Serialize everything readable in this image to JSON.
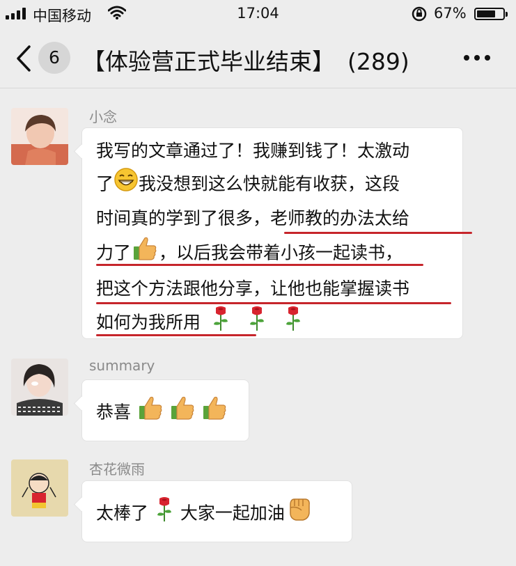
{
  "status_bar": {
    "carrier": "中国移动",
    "time": "17:04",
    "battery_percent": "67%",
    "battery_level": 0.67
  },
  "nav": {
    "unread_count": "6",
    "title": "【体验营正式毕业结束】",
    "member_count": "(289)"
  },
  "messages": [
    {
      "sender": "小念",
      "lines": [
        {
          "parts": [
            "我写的文章通过了！我赚到钱了！太激动"
          ]
        },
        {
          "parts": [
            "了",
            "{grin-emoji}",
            "我没想到这么快就能有收获，这段"
          ]
        },
        {
          "parts": [
            "时间真的学到了很多，",
            "老师教的办法太给"
          ]
        },
        {
          "parts": [
            "力了",
            "{thumbs-up-emoji}",
            "，以后我会带着小孩一起读书，"
          ]
        },
        {
          "parts": [
            "把这个方法跟他分享，让他也能掌握读书"
          ]
        },
        {
          "parts": [
            "如何为我所用",
            "{rose-emoji}",
            "{rose-emoji}",
            "{rose-emoji}"
          ]
        }
      ]
    },
    {
      "sender": "summary",
      "text": "恭喜",
      "emojis": [
        "thumbs-up-emoji",
        "thumbs-up-emoji",
        "thumbs-up-emoji"
      ]
    },
    {
      "sender": "杏花微雨",
      "text_before": "太棒了",
      "text_after": "大家一起加油",
      "emojis": [
        "rose-emoji",
        "fist-emoji"
      ]
    }
  ],
  "colors": {
    "background": "#ededed",
    "bubble": "#ffffff",
    "underline": "#c6252b",
    "name": "#8a8a8a"
  },
  "text": {
    "m1_l1": "我写的文章通过了！我赚到钱了！太激动",
    "m1_l2a": "了",
    "m1_l2b": "我没想到这么快就能有收获，这段",
    "m1_l3a": "时间真的学到了很多，",
    "m1_l3b": "老师教的办法太给",
    "m1_l4a": "力了",
    "m1_l4b": "，以后我会带着小孩一起读书，",
    "m1_l5": "把这个方法跟他分享，让他也能掌握读书",
    "m1_l6": "如何为我所用",
    "m2": "恭喜",
    "m3a": "太棒了",
    "m3b": "大家一起加油"
  }
}
